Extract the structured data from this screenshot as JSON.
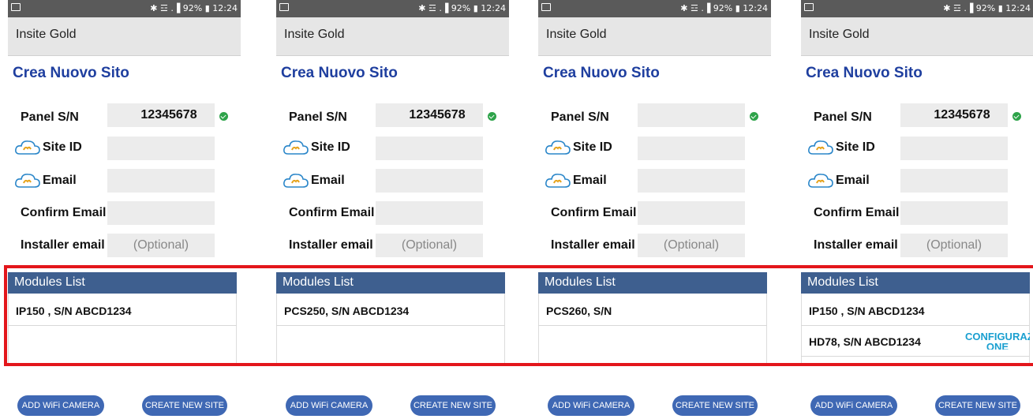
{
  "status_bar": {
    "right_text": "✱ ☲ .▐ 92% ▮ 12:24"
  },
  "app_title": "Insite Gold",
  "page_title": "Crea Nuovo Sito",
  "labels": {
    "panel_sn": "Panel S/N",
    "site_id": "Site ID",
    "email": "Email",
    "confirm_email": "Confirm Email:",
    "installer_email": "Installer email"
  },
  "installer_placeholder": "(Optional)",
  "modules_header": "Modules List",
  "buttons": {
    "add_wifi": "ADD WiFi CAMERA",
    "create_site": "CREATE NEW SITE"
  },
  "configure_label": "CONFIGURAZI ONE",
  "colors": {
    "title_blue": "#1f3f9f",
    "header_blue": "#3e5f8f",
    "button_blue": "#3f68b4",
    "check_green": "#2ea34a",
    "highlight_red": "#e3161b",
    "link_blue": "#1a9fd0"
  },
  "screens": [
    {
      "panel_sn": "12345678",
      "modules": [
        "IP150 , S/N ABCD1234"
      ]
    },
    {
      "panel_sn": "12345678",
      "modules": [
        "PCS250, S/N ABCD1234"
      ]
    },
    {
      "panel_sn": "",
      "modules": [
        "PCS260, S/N"
      ]
    },
    {
      "panel_sn": "12345678",
      "modules": [
        "IP150 , S/N ABCD1234",
        "HD78, S/N ABCD1234"
      ]
    }
  ]
}
